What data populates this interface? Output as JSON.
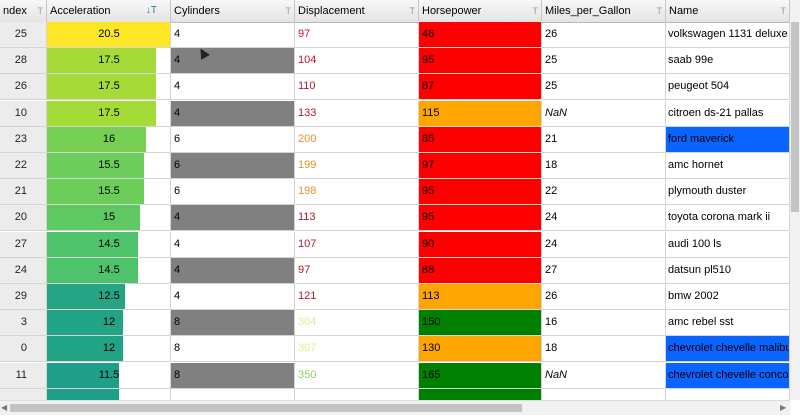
{
  "header": {
    "index": "ndex",
    "acceleration": "Acceleration",
    "cylinders": "Cylinders",
    "displacement": "Displacement",
    "horsepower": "Horsepower",
    "mpg": "Miles_per_Gallon",
    "name": "Name",
    "filter_glyph": "T",
    "sort_glyph": "↓T"
  },
  "rows": [
    {
      "index": "25",
      "acc": "20.5",
      "acc_frac": 1.0,
      "acc_color": "#fde725",
      "cyl": "4",
      "cyl_shade": 0,
      "disp": "97",
      "disp_color": "#b2182b",
      "hp": "46",
      "hp_color": "#ff0000",
      "mpg": "26",
      "mpg_nan": false,
      "name": "volkswagen 1131 deluxe sedan",
      "name_hl": false
    },
    {
      "index": "28",
      "acc": "17.5",
      "acc_frac": 0.88,
      "acc_color": "#a5db36",
      "cyl": "4",
      "cyl_shade": 1,
      "disp": "104",
      "disp_color": "#b2182b",
      "hp": "95",
      "hp_color": "#ff0000",
      "mpg": "25",
      "mpg_nan": false,
      "name": "saab 99e",
      "name_hl": false
    },
    {
      "index": "26",
      "acc": "17.5",
      "acc_frac": 0.88,
      "acc_color": "#a5db36",
      "cyl": "4",
      "cyl_shade": 0,
      "disp": "110",
      "disp_color": "#b2182b",
      "hp": "87",
      "hp_color": "#ff0000",
      "mpg": "25",
      "mpg_nan": false,
      "name": "peugeot 504",
      "name_hl": false
    },
    {
      "index": "10",
      "acc": "17.5",
      "acc_frac": 0.88,
      "acc_color": "#a5db36",
      "cyl": "4",
      "cyl_shade": 1,
      "disp": "133",
      "disp_color": "#b2182b",
      "hp": "115",
      "hp_color": "#ffa500",
      "mpg": "NaN",
      "mpg_nan": true,
      "name": "citroen ds-21 pallas",
      "name_hl": false
    },
    {
      "index": "23",
      "acc": "16",
      "acc_frac": 0.8,
      "acc_color": "#75d054",
      "cyl": "6",
      "cyl_shade": 0,
      "disp": "200",
      "disp_color": "#e6902f",
      "hp": "85",
      "hp_color": "#ff0000",
      "mpg": "21",
      "mpg_nan": false,
      "name": "ford maverick",
      "name_hl": true
    },
    {
      "index": "22",
      "acc": "15.5",
      "acc_frac": 0.78,
      "acc_color": "#6ccd5a",
      "cyl": "6",
      "cyl_shade": 1,
      "disp": "199",
      "disp_color": "#e6902f",
      "hp": "97",
      "hp_color": "#ff0000",
      "mpg": "18",
      "mpg_nan": false,
      "name": "amc hornet",
      "name_hl": false
    },
    {
      "index": "21",
      "acc": "15.5",
      "acc_frac": 0.78,
      "acc_color": "#6ccd5a",
      "cyl": "6",
      "cyl_shade": 0,
      "disp": "198",
      "disp_color": "#e6902f",
      "hp": "95",
      "hp_color": "#ff0000",
      "mpg": "22",
      "mpg_nan": false,
      "name": "plymouth duster",
      "name_hl": false
    },
    {
      "index": "20",
      "acc": "15",
      "acc_frac": 0.75,
      "acc_color": "#5ec962",
      "cyl": "4",
      "cyl_shade": 1,
      "disp": "113",
      "disp_color": "#b2182b",
      "hp": "95",
      "hp_color": "#ff0000",
      "mpg": "24",
      "mpg_nan": false,
      "name": "toyota corona mark ii",
      "name_hl": false
    },
    {
      "index": "27",
      "acc": "14.5",
      "acc_frac": 0.73,
      "acc_color": "#4ec36b",
      "cyl": "4",
      "cyl_shade": 0,
      "disp": "107",
      "disp_color": "#b2182b",
      "hp": "90",
      "hp_color": "#ff0000",
      "mpg": "24",
      "mpg_nan": false,
      "name": "audi 100 ls",
      "name_hl": false
    },
    {
      "index": "24",
      "acc": "14.5",
      "acc_frac": 0.73,
      "acc_color": "#4ec36b",
      "cyl": "4",
      "cyl_shade": 1,
      "disp": "97",
      "disp_color": "#b2182b",
      "hp": "88",
      "hp_color": "#ff0000",
      "mpg": "27",
      "mpg_nan": false,
      "name": "datsun pl510",
      "name_hl": false
    },
    {
      "index": "29",
      "acc": "12.5",
      "acc_frac": 0.63,
      "acc_color": "#25a584",
      "cyl": "4",
      "cyl_shade": 0,
      "disp": "121",
      "disp_color": "#b2182b",
      "hp": "113",
      "hp_color": "#ffa500",
      "mpg": "26",
      "mpg_nan": false,
      "name": "bmw 2002",
      "name_hl": false
    },
    {
      "index": "3",
      "acc": "12",
      "acc_frac": 0.61,
      "acc_color": "#21a385",
      "cyl": "8",
      "cyl_shade": 1,
      "disp": "304",
      "disp_color": "#d9ef8b",
      "hp": "150",
      "hp_color": "#008000",
      "mpg": "16",
      "mpg_nan": false,
      "name": "amc rebel sst",
      "name_hl": false
    },
    {
      "index": "0",
      "acc": "12",
      "acc_frac": 0.61,
      "acc_color": "#21a385",
      "cyl": "8",
      "cyl_shade": 0,
      "disp": "307",
      "disp_color": "#d9ef8b",
      "hp": "130",
      "hp_color": "#ffa500",
      "mpg": "18",
      "mpg_nan": false,
      "name": "chevrolet chevelle malibu",
      "name_hl": true
    },
    {
      "index": "11",
      "acc": "11.5",
      "acc_frac": 0.58,
      "acc_color": "#1f9e89",
      "cyl": "8",
      "cyl_shade": 1,
      "disp": "350",
      "disp_color": "#91cf60",
      "hp": "165",
      "hp_color": "#008000",
      "mpg": "NaN",
      "mpg_nan": true,
      "name": "chevrolet chevelle concours",
      "name_hl": true
    },
    {
      "index": "",
      "acc": "",
      "acc_frac": 0.58,
      "acc_color": "#1f9e89",
      "cyl": "",
      "cyl_shade": 0,
      "disp": "",
      "disp_color": "#000000",
      "hp": "",
      "hp_color": "#008000",
      "mpg": "",
      "mpg_nan": false,
      "name": "",
      "name_hl": false
    }
  ],
  "colors": {
    "name_highlight": "#0a64ff",
    "cylinder_shade": "#808080"
  }
}
